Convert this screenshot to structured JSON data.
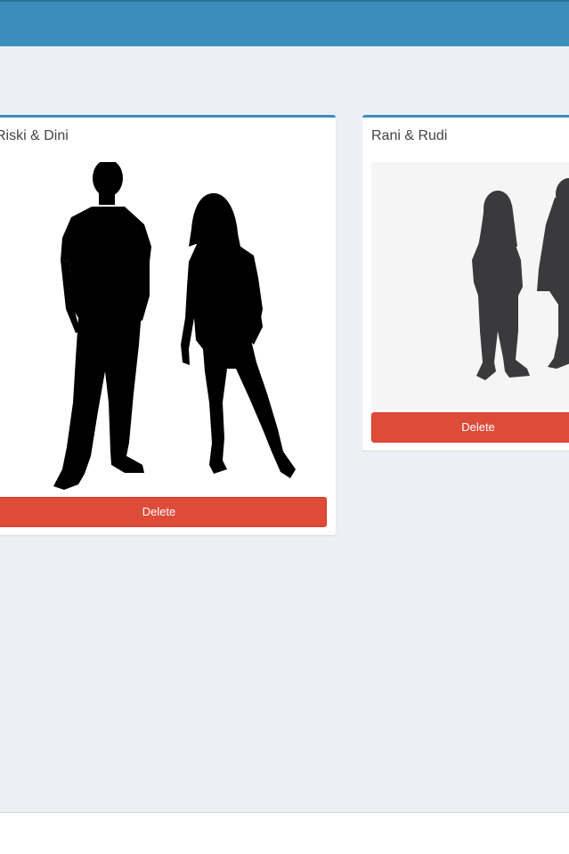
{
  "colors": {
    "header": "#3c8dbc",
    "background": "#ecf0f5",
    "card": "#ffffff",
    "danger": "#dd4b39"
  },
  "cards": [
    {
      "title": "Riski & Dini",
      "image": "couple-silhouette-icon",
      "delete_label": "Delete"
    },
    {
      "title": "Rani & Rudi",
      "image": "couple-silhouette-icon",
      "delete_label": "Delete"
    }
  ]
}
